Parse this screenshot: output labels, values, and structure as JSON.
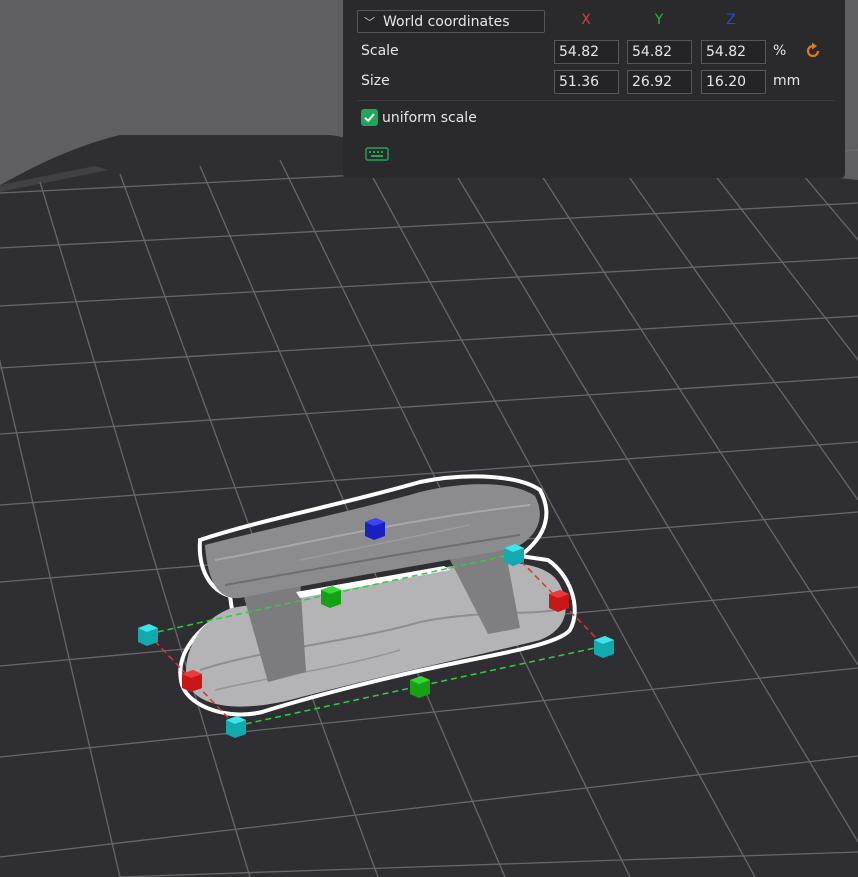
{
  "panel": {
    "coordinate_system": "World coordinates",
    "axes": {
      "x": "X",
      "y": "Y",
      "z": "Z"
    },
    "scale_label": "Scale",
    "size_label": "Size",
    "scale": {
      "x": "54.82",
      "y": "54.82",
      "z": "54.82",
      "unit": "%"
    },
    "size": {
      "x": "51.36",
      "y": "26.92",
      "z": "16.20",
      "unit": "mm"
    },
    "uniform_scale_label": "uniform scale",
    "uniform_scale_checked": true,
    "icons": {
      "reset": "reset-arrow-icon",
      "keyboard": "keyboard-icon"
    }
  },
  "colors": {
    "x_axis": "#d93b3b",
    "y_axis": "#27b82c",
    "z_axis": "#2c43d6",
    "accent_reset": "#e07a1f",
    "check": "#1fa65a",
    "handle_cyan": "#19c9cf"
  }
}
